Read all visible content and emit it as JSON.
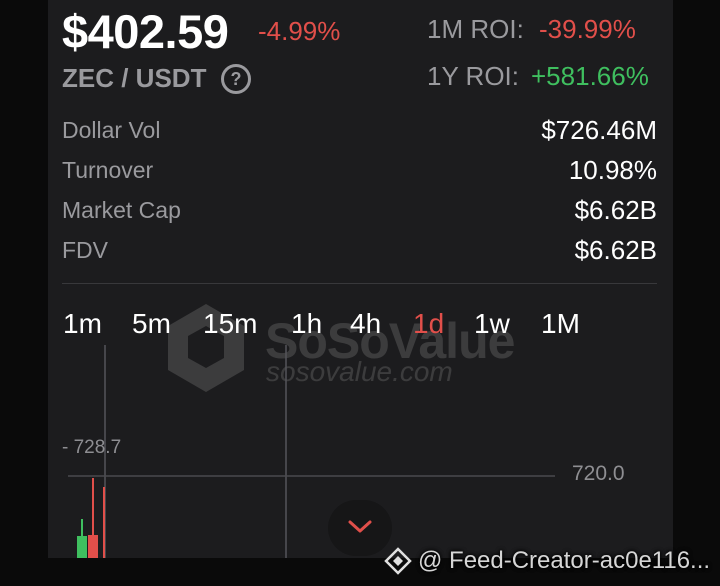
{
  "ticker": {
    "price": "$402.59",
    "change": "-4.99%",
    "pair": "ZEC / USDT",
    "help_icon": "question-circle-icon"
  },
  "roi": {
    "m1_label": "1M ROI:",
    "m1_value": "-39.99%",
    "y1_label": "1Y ROI:",
    "y1_value": "+581.66%"
  },
  "stats": [
    {
      "label": "Dollar Vol",
      "value": "$726.46M"
    },
    {
      "label": "Turnover",
      "value": "10.98%"
    },
    {
      "label": "Market Cap",
      "value": "$6.62B"
    },
    {
      "label": "FDV",
      "value": "$6.62B"
    }
  ],
  "timeframes": [
    {
      "label": "1m"
    },
    {
      "label": "5m"
    },
    {
      "label": "15m"
    },
    {
      "label": "1h"
    },
    {
      "label": "4h"
    },
    {
      "label": "1d",
      "active": true
    },
    {
      "label": "1w"
    },
    {
      "label": "1M"
    }
  ],
  "watermark": {
    "brand": "SoSoValue",
    "domain": "sosovalue.com"
  },
  "chart": {
    "high_marker": "- 728.7",
    "price_line_label": "720.0",
    "expand_icon": "chevron-down-icon"
  },
  "footer": {
    "icon": "diamond-icon",
    "text": "@ Feed-Creator-ac0e116..."
  },
  "colors": {
    "up": "#3fbf5f",
    "down": "#e14f4a",
    "background": "#1c1c1e"
  }
}
